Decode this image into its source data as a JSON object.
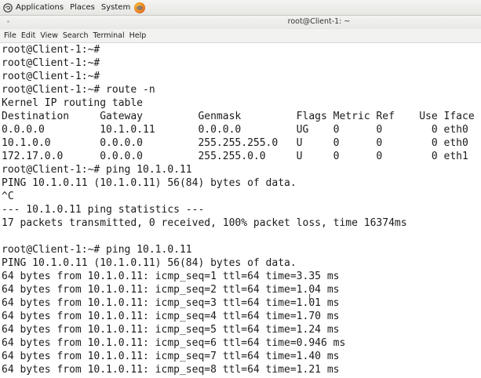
{
  "panel": {
    "applications": "Applications",
    "places": "Places",
    "system": "System"
  },
  "window": {
    "title": "root@Client-1: ~"
  },
  "menubar": {
    "file": "File",
    "edit": "Edit",
    "view": "View",
    "search": "Search",
    "terminal": "Terminal",
    "help": "Help"
  },
  "terminal": {
    "lines": [
      "root@Client-1:~#",
      "root@Client-1:~#",
      "root@Client-1:~#",
      "root@Client-1:~# route -n",
      "Kernel IP routing table",
      "Destination     Gateway         Genmask         Flags Metric Ref    Use Iface",
      "0.0.0.0         10.1.0.11       0.0.0.0         UG    0      0        0 eth0",
      "10.1.0.0        0.0.0.0         255.255.255.0   U     0      0        0 eth0",
      "172.17.0.0      0.0.0.0         255.255.0.0     U     0      0        0 eth1",
      "root@Client-1:~# ping 10.1.0.11",
      "PING 10.1.0.11 (10.1.0.11) 56(84) bytes of data.",
      "^C",
      "--- 10.1.0.11 ping statistics ---",
      "17 packets transmitted, 0 received, 100% packet loss, time 16374ms",
      "",
      "root@Client-1:~# ping 10.1.0.11",
      "PING 10.1.0.11 (10.1.0.11) 56(84) bytes of data.",
      "64 bytes from 10.1.0.11: icmp_seq=1 ttl=64 time=3.35 ms",
      "64 bytes from 10.1.0.11: icmp_seq=2 ttl=64 time=1.04 ms",
      "64 bytes from 10.1.0.11: icmp_seq=3 ttl=64 time=1.01 ms",
      "64 bytes from 10.1.0.11: icmp_seq=4 ttl=64 time=1.70 ms",
      "64 bytes from 10.1.0.11: icmp_seq=5 ttl=64 time=1.24 ms",
      "64 bytes from 10.1.0.11: icmp_seq=6 ttl=64 time=0.946 ms",
      "64 bytes from 10.1.0.11: icmp_seq=7 ttl=64 time=1.40 ms",
      "64 bytes from 10.1.0.11: icmp_seq=8 ttl=64 time=1.21 ms"
    ]
  },
  "icons": {
    "distro_logo": "distro-logo-icon",
    "browser": "firefox-icon",
    "mouse_cursor": "text-cursor-icon"
  }
}
